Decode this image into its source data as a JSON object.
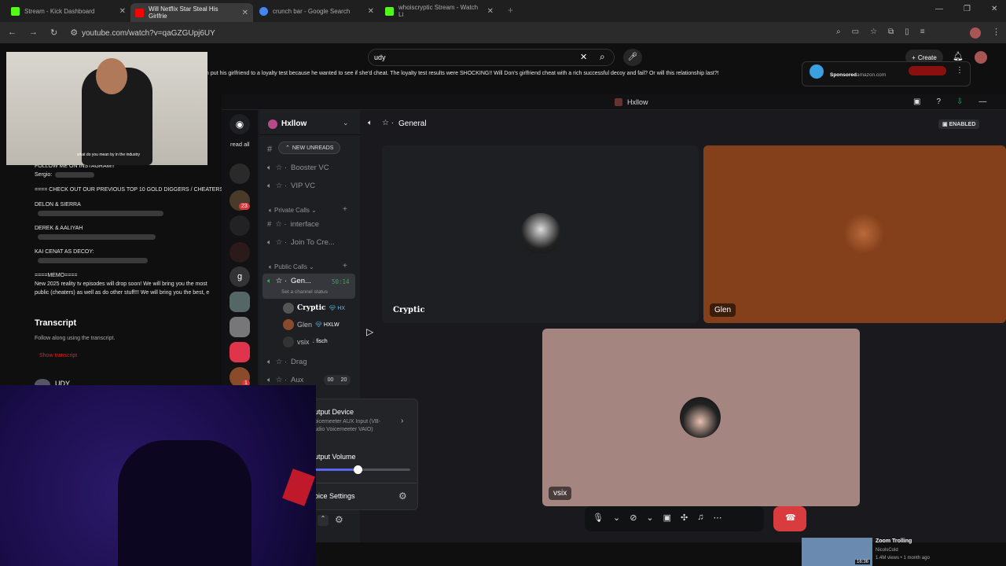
{
  "tabs": [
    {
      "title": "Stream - Kick Dashboard",
      "color": "#53fc18",
      "active": false
    },
    {
      "title": "Will Netflix Star Steal His Girlfrie",
      "color": "#ff0000",
      "active": true
    },
    {
      "title": "crunch bar - Google Search",
      "color": "#4285f4",
      "active": false
    },
    {
      "title": "whoiscryptic Stream - Watch Li",
      "color": "#53fc18",
      "active": false
    }
  ],
  "address": {
    "url": "youtube.com/watch?v=qaGZGUpj6UY"
  },
  "youtube": {
    "search_value": "udy",
    "create_label": "Create",
    "description_line": "n put his girlfriend to a loyalty test because he wanted to see if she'd cheat. The loyalty test results were SHOCKING!! Will Don's girlfriend cheat with a rich successful decoy and fail? Or will this relationship last?!",
    "ad": {
      "sponsored": "Sponsored",
      "domain": "amazon.com"
    },
    "desc": {
      "follow": "FOLLOW ME ON INSTAGRAM!!",
      "sergio": "Sergio:",
      "check_out": "==== CHECK OUT OUR PREVIOUS TOP 10 GOLD DIGGERS / CHEATERS",
      "delon": "DELON & SIERRA",
      "derek": "DEREK & AALIYAH",
      "kai": "KAI CENAT AS DECOY:",
      "memo": "====MEMO====",
      "memo1": "New 2025 reality tv episodes will drop soon! We will bring you the most",
      "memo2": "public (cheaters) as well as do other stuff!!! We will bring you the best, e"
    },
    "transcript_title": "Transcript",
    "transcript_sub": "Follow along using the transcript.",
    "show_transcript": "Show transcript",
    "channel": "UDY",
    "cam_caption": "what do you mean by in the industry",
    "rec": {
      "title": "Zoom Trolling",
      "channel": "NicolsCold",
      "meta": "1.4M views • 1 month ago",
      "duration": "16:36"
    }
  },
  "discord": {
    "window_title": "Hxllow",
    "read_all": "read all",
    "server_name": "Hxllow",
    "new_unreads": "NEW UNREADS",
    "badges": {
      "b1": "23",
      "b2": "1"
    },
    "channels": {
      "booster": "Booster VC",
      "vip": "VIP VC",
      "private_cat": "Private Calls",
      "interface": "interface",
      "join": "Join To Cre...",
      "public_cat": "Public Calls",
      "general": "Gen...",
      "general_time": "50:14",
      "status": "Set a channel status",
      "drag": "Drag",
      "aux": "Aux",
      "aux_a": "00",
      "aux_b": "20"
    },
    "members": [
      {
        "name": "Cryptic",
        "tag": "HX",
        "color": "#555"
      },
      {
        "name": "Glen",
        "tag": "HXLW",
        "color": "#8a4b2a"
      },
      {
        "name": "vsix",
        "tag": "fisch",
        "color": "#333"
      }
    ],
    "voice_header": "General",
    "enabled": "ENABLED",
    "tiles": [
      {
        "name": "Cryptic",
        "bg": "#1e1f22"
      },
      {
        "name": "Glen",
        "bg": "#84401b"
      },
      {
        "name": "vsix",
        "bg": "#a58580"
      }
    ],
    "popup": {
      "output_device": "utput Device",
      "device_line1": "oicemeeter AUX Input (VB-",
      "device_line2": "udio Voicemeeter VAIO)",
      "output_volume": "utput Volume",
      "volume_level": 0.45,
      "voice_settings": "oice Settings"
    }
  }
}
